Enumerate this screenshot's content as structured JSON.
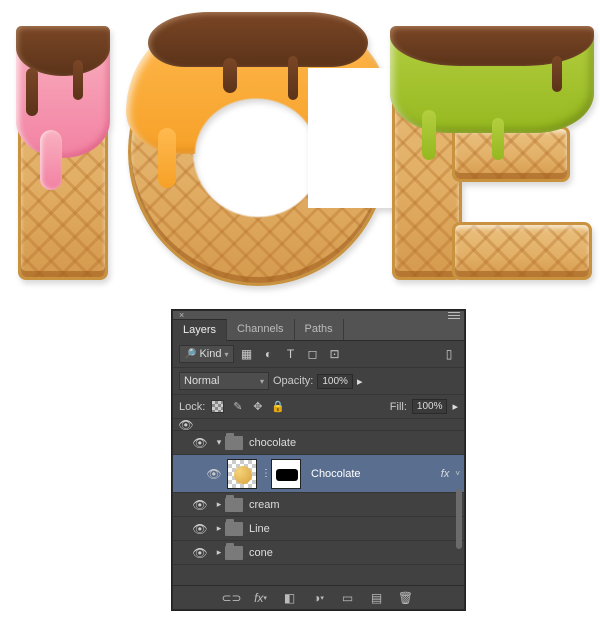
{
  "artwork": {
    "text": "ICE",
    "cream_colors": [
      "#f281a2",
      "#f6a128",
      "#95b81f"
    ],
    "chocolate_color": "#5b3319",
    "waffle_color": "#e2af66"
  },
  "panel": {
    "tabs": {
      "layers": "Layers",
      "channels": "Channels",
      "paths": "Paths"
    },
    "filter": {
      "label": "Kind"
    },
    "blend": {
      "mode": "Normal",
      "opacity_label": "Opacity:",
      "opacity_value": "100%"
    },
    "lock": {
      "label": "Lock:",
      "fill_label": "Fill:",
      "fill_value": "100%"
    },
    "layers": {
      "group": "chocolate",
      "selected": "Chocolate",
      "fx": "fx",
      "folder_cream": "cream",
      "folder_line": "Line",
      "folder_cone": "cone"
    },
    "footer_icons": [
      "link",
      "fx",
      "mask",
      "adjust",
      "group",
      "new",
      "trash"
    ]
  }
}
